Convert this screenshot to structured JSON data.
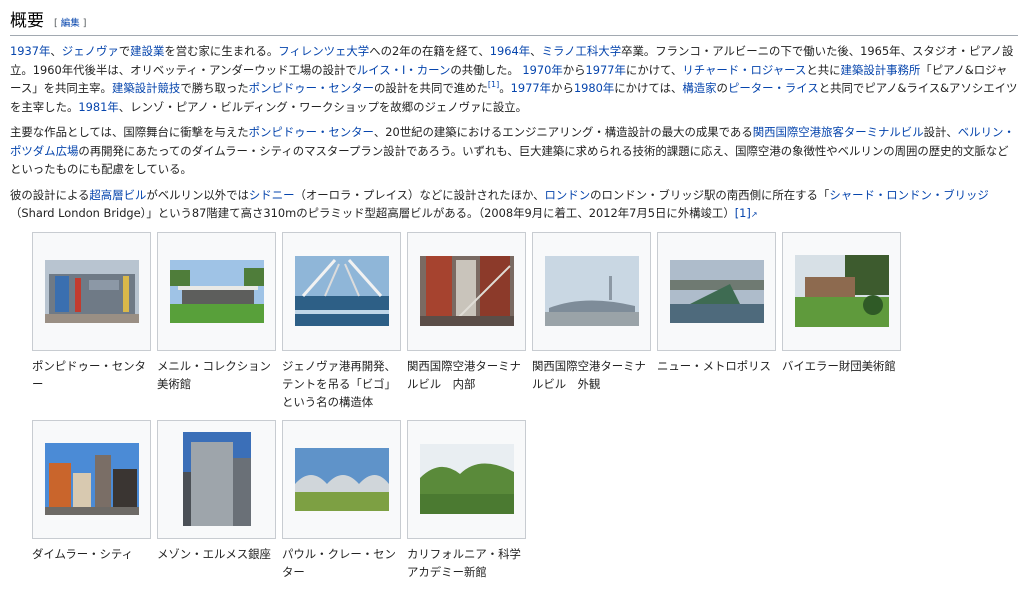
{
  "section": {
    "title": "概要",
    "edit_open": "[",
    "edit_label": "編集",
    "edit_close": "]"
  },
  "p1": {
    "s1": "1937年",
    "s2": "、",
    "s3": "ジェノヴァ",
    "s4": "で",
    "s5": "建設業",
    "s6": "を営む家に生まれる。",
    "s7": "フィレンツェ大学",
    "s8": "への2年の在籍を経て、",
    "s9": "1964年",
    "s10": "、",
    "s11": "ミラノ工科大学",
    "s12": "卒業。フランコ・アルビーニの下で働いた後、1965年、スタジオ・ピアノ設立。1960年代後半は、オリベッティ・アンダーウッド工場の設計で",
    "s13": "ルイス・I・カーン",
    "s14": "の共働した。 ",
    "s15": "1970年",
    "s16": "から",
    "s17": "1977年",
    "s18": "にかけて、",
    "s19": "リチャード・ロジャース",
    "s20": "と共に",
    "s21": "建築設計事務所",
    "s22": "「ピアノ&ロジャース」を共同主宰。",
    "s23": "建築設計競技",
    "s24": "で勝ち取った",
    "s25": "ポンピドゥー・センター",
    "s26": "の設計を共同で進めた",
    "s27": "[1]",
    "s28": "。",
    "s29": "1977年",
    "s30": "から",
    "s31": "1980年",
    "s32": "にかけては、",
    "s33": "構造家",
    "s34": "の",
    "s35": "ピーター・ライス",
    "s36": "と共同でピアノ&ライス&アソシエイツを主宰した。",
    "s37": "1981年",
    "s38": "、レンゾ・ピアノ・ビルディング・ワークショップを故郷のジェノヴァに設立。"
  },
  "p2": {
    "s1": "主要な作品としては、国際舞台に衝撃を与えた",
    "s2": "ポンピドゥー・センター",
    "s3": "、20世紀の建築におけるエンジニアリング・構造設計の最大の成果である",
    "s4": "関西国際空港旅客ターミナルビル",
    "s5": "設計、",
    "s6": "ベルリン・ポツダム広場",
    "s7": "の再開発にあたってのダイムラー・シティのマスタープラン設計であろう。いずれも、巨大建築に求められる技術的課題に応え、国際空港の象徴性やベルリンの周囲の歴史的文脈などといったものにも配慮をしている。"
  },
  "p3": {
    "s1": "彼の設計による",
    "s2": "超高層ビル",
    "s3": "がベルリン以外では",
    "s4": "シドニー",
    "s5": "（オーロラ・プレイス）などに設計されたほか、",
    "s6": "ロンドン",
    "s7": "のロンドン・ブリッジ駅の南西側に所在する「",
    "s8": "シャード・ロンドン・ブリッジ",
    "s9": "（Shard London Bridge）」という87階建て高さ310mのピラミッド型超高層ビルがある。（2008年9月に着工、2012年7月5日に外構竣工）",
    "s10": "[1]"
  },
  "gallery": [
    {
      "caption": "ポンピドゥー・センター"
    },
    {
      "caption": "メニル・コレクション美術館"
    },
    {
      "caption": "ジェノヴァ港再開発、テントを吊る「ビゴ」という名の構造体"
    },
    {
      "caption": "関西国際空港ターミナルビル　内部"
    },
    {
      "caption": "関西国際空港ターミナルビル　外観"
    },
    {
      "caption": "ニュー・メトロポリス"
    },
    {
      "caption": "バイエラー財団美術館"
    },
    {
      "caption": "ダイムラー・シティ"
    },
    {
      "caption": "メゾン・エルメス銀座"
    },
    {
      "caption": "パウル・クレー・センター"
    },
    {
      "caption": "カリフォルニア・科学アカデミー新館"
    }
  ],
  "colors": {
    "link": "#0645ad",
    "text": "#222222",
    "border": "#a2a9b1"
  }
}
